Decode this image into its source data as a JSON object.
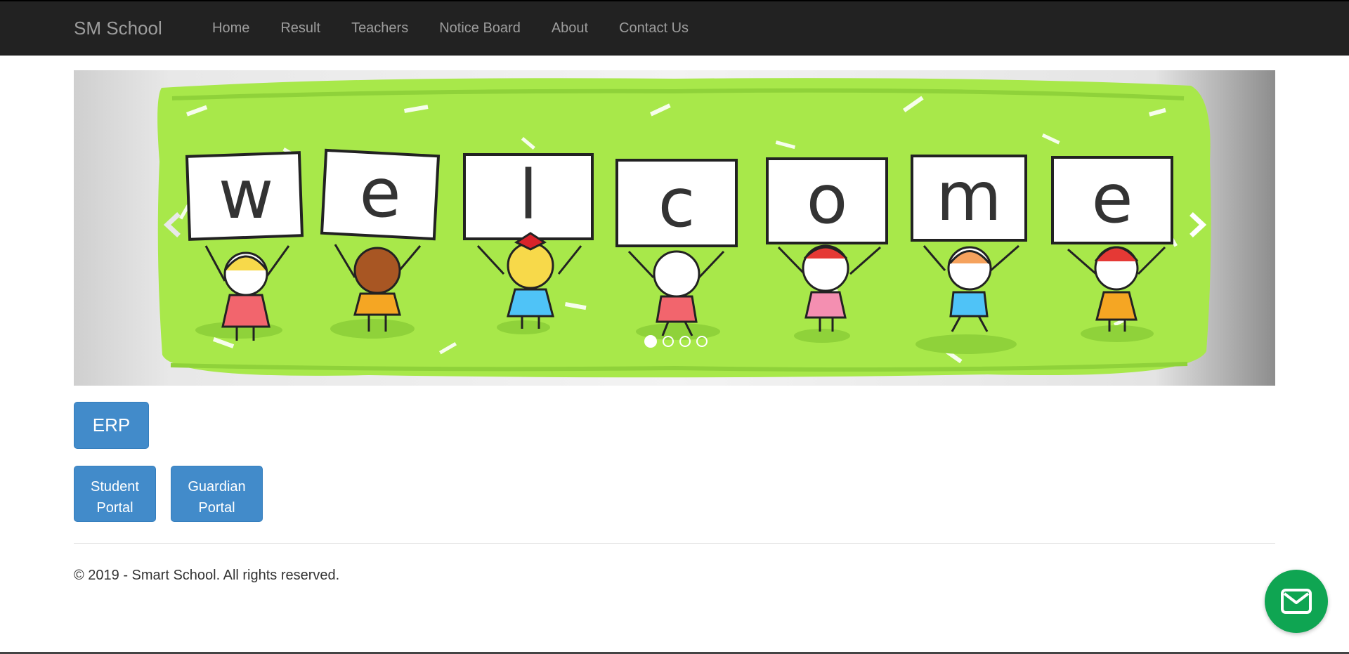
{
  "navbar": {
    "brand": "SM School",
    "items": [
      {
        "label": "Home"
      },
      {
        "label": "Result"
      },
      {
        "label": "Teachers"
      },
      {
        "label": "Notice Board"
      },
      {
        "label": "About"
      },
      {
        "label": "Contact Us"
      }
    ]
  },
  "carousel": {
    "letters": [
      "w",
      "e",
      "l",
      "c",
      "o",
      "m",
      "e"
    ],
    "slides": 4,
    "active_slide": 1,
    "prev_icon": "chevron-left-icon",
    "next_icon": "chevron-right-icon"
  },
  "buttons": {
    "erp": "ERP",
    "student_line1": "Student",
    "student_line2": "Portal",
    "guardian_line1": "Guardian",
    "guardian_line2": "Portal"
  },
  "footer": {
    "copyright": "© 2019 - Smart School. All rights reserved."
  },
  "chat": {
    "icon": "mail-icon"
  },
  "colors": {
    "navbar": "#222222",
    "button": "#428bca",
    "chat": "#0fa552",
    "banner_green": "#a8e84a"
  }
}
